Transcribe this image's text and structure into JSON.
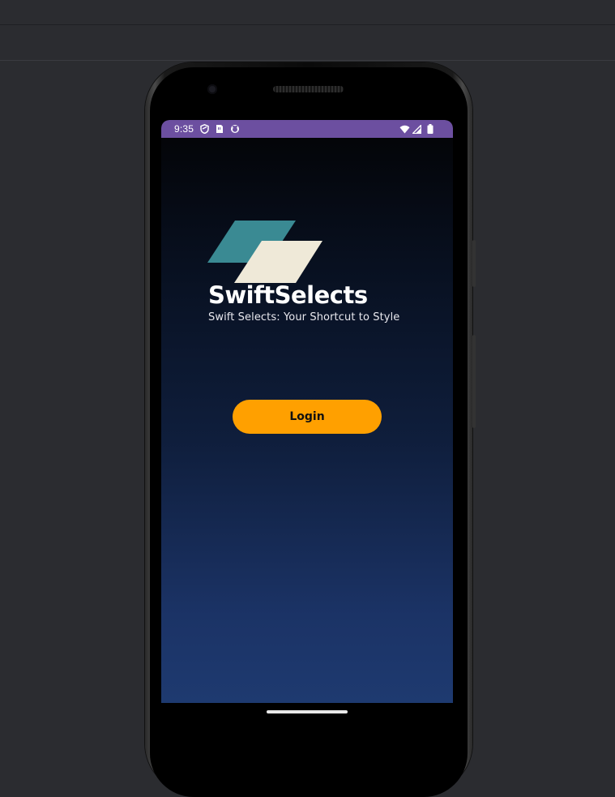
{
  "status_bar": {
    "time": "9:35",
    "left_icons": [
      "shield-icon",
      "sim-card-icon",
      "face-icon"
    ],
    "right_icons": [
      "wifi-icon",
      "signal-icon",
      "battery-icon"
    ],
    "color": "#6c4fa0"
  },
  "app": {
    "brand_name": "SwiftSelects",
    "tagline": "Swift Selects: Your Shortcut to Style",
    "logo_colors": {
      "top": "#3a8a93",
      "bottom": "#efe9d8"
    }
  },
  "login": {
    "label": "Login",
    "color": "#ffa000"
  }
}
